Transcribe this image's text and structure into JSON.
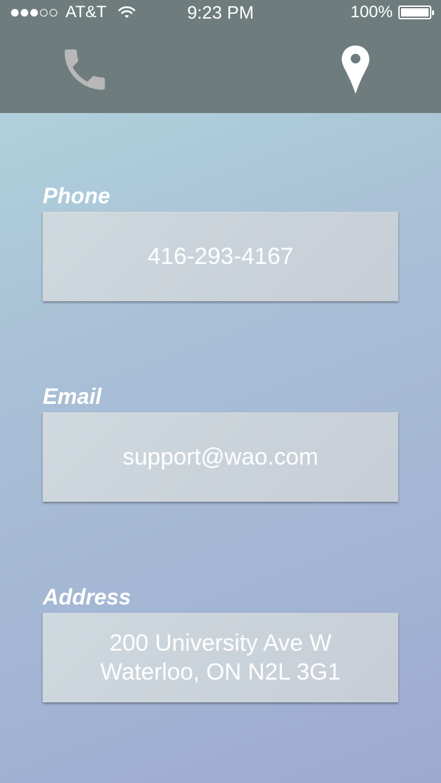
{
  "status_bar": {
    "carrier": "AT&T",
    "time": "9:23 PM",
    "battery": "100%",
    "signal_filled": 3,
    "signal_total": 5
  },
  "tabs": {
    "phone_icon": "phone-icon",
    "map_icon": "map-pin-icon"
  },
  "contact": {
    "phone_label": "Phone",
    "phone_value": "416-293-4167",
    "email_label": "Email",
    "email_value": "support@wao.com",
    "address_label": "Address",
    "address_line1": "200 University Ave W",
    "address_line2": "Waterloo, ON N2L 3G1"
  },
  "colors": {
    "header_bg": "#6e7c7d",
    "phone_icon": "#b8b8b8",
    "map_icon": "#ffffff"
  }
}
